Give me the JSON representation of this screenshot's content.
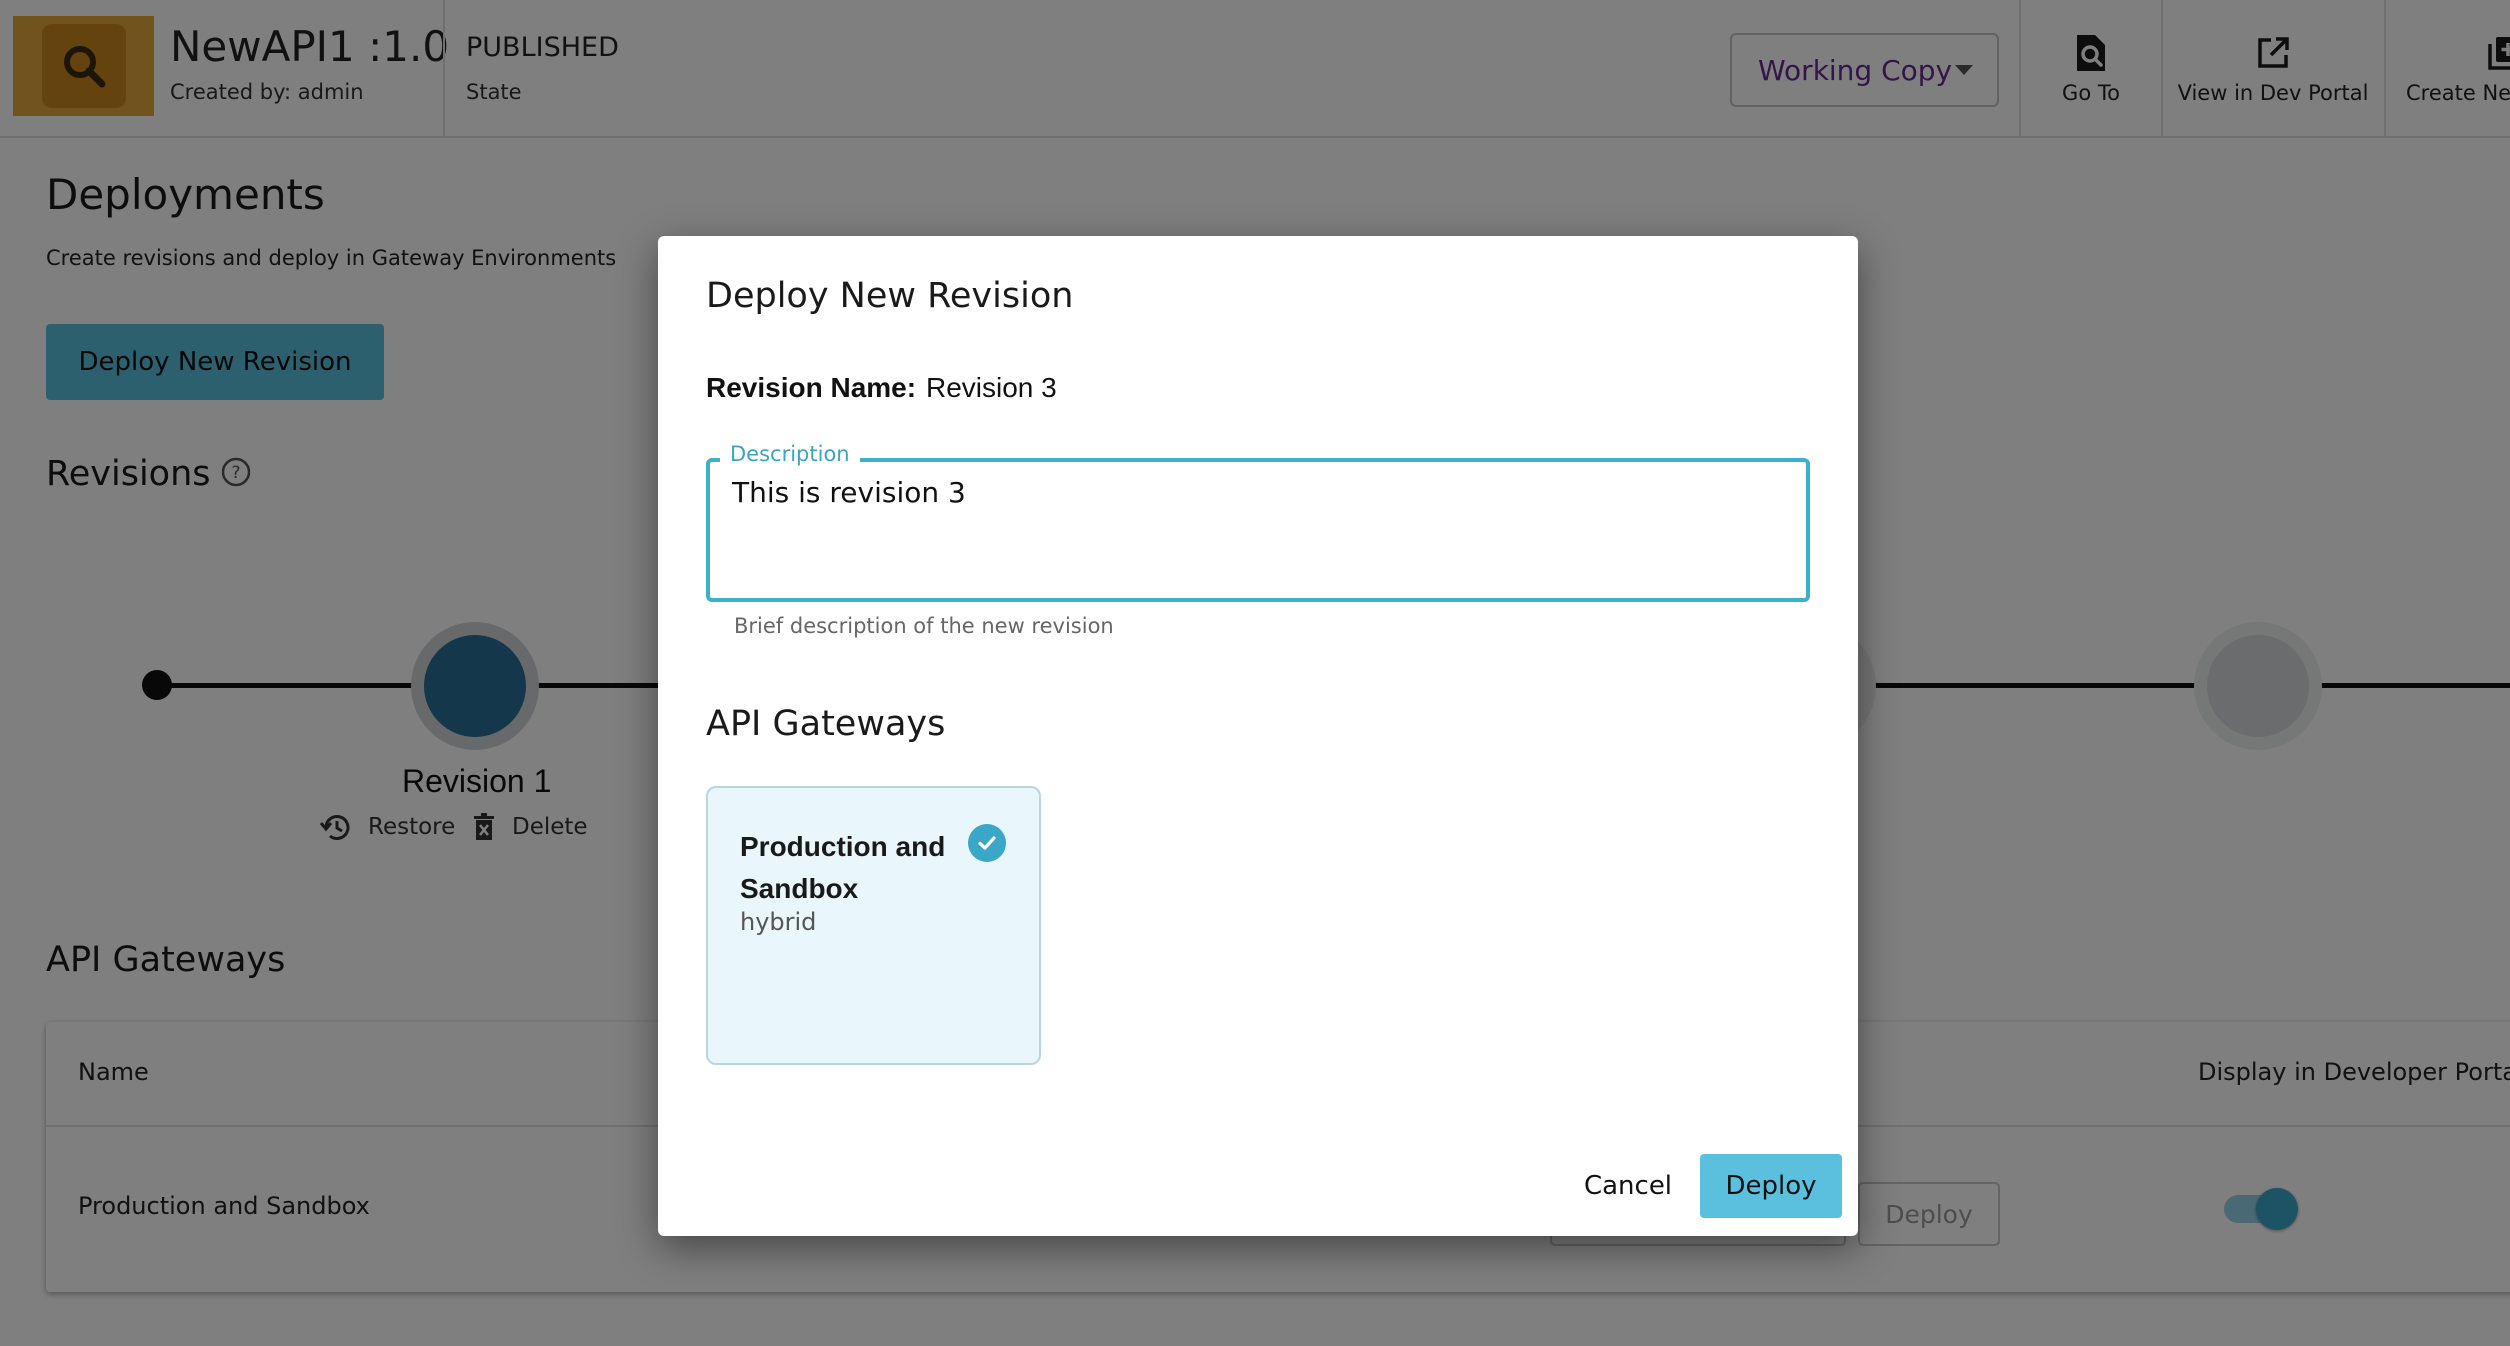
{
  "header": {
    "api_title": "NewAPI1 :1.0",
    "created_by": "Created by: admin",
    "state_value": "PUBLISHED",
    "state_label": "State",
    "version_select": "Working Copy",
    "actions": [
      {
        "label": "Go To",
        "icon": "search-document-icon"
      },
      {
        "label": "View in Dev Portal",
        "icon": "external-link-icon"
      },
      {
        "label": "Create Nev",
        "icon": "add-copy-icon"
      }
    ]
  },
  "page": {
    "title": "Deployments",
    "subtitle": "Create revisions and deploy in Gateway Environments",
    "deploy_button": "Deploy New Revision",
    "revisions_title": "Revisions",
    "revision1_label": "Revision 1",
    "restore_label": "Restore",
    "delete_label": "Delete",
    "gateways_title": "API Gateways",
    "table": {
      "columns": [
        "Name",
        "Display in Developer Portal"
      ],
      "rows": [
        {
          "name": "Production and Sandbox",
          "deploy_label": "Deploy",
          "display_enabled": true
        }
      ]
    }
  },
  "dialog": {
    "title": "Deploy New Revision",
    "revision_name_label": "Revision Name:",
    "revision_name_value": "Revision 3",
    "description_legend": "Description",
    "description_value": "This is revision 3",
    "description_help": "Brief description of the new revision",
    "gateways_title": "API Gateways",
    "gateway_card": {
      "name": "Production and Sandbox",
      "type": "hybrid",
      "selected": true
    },
    "cancel_label": "Cancel",
    "deploy_label": "Deploy"
  },
  "colors": {
    "accent": "#5bc0de",
    "focus_border": "#3cb0cc",
    "check": "#3aa6c8",
    "select_text": "#6a2a93",
    "logo": "#e2a93a"
  }
}
